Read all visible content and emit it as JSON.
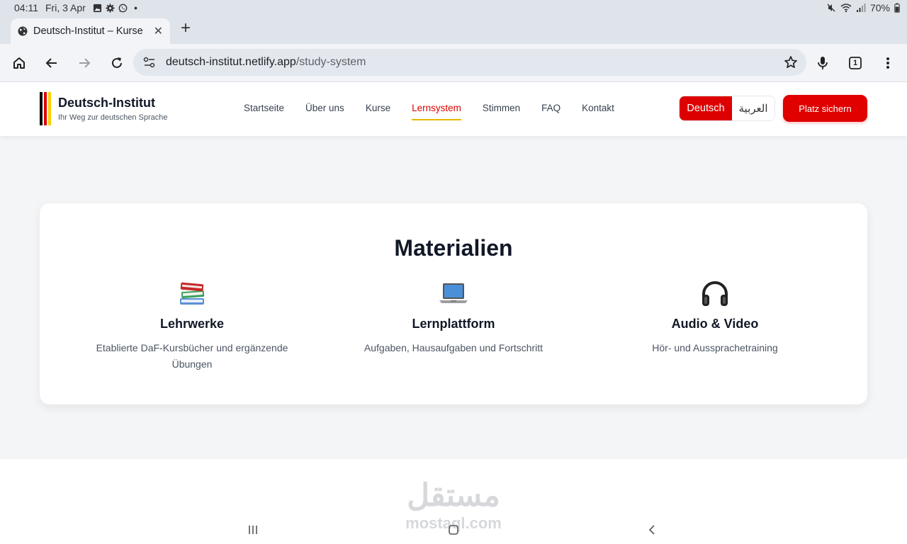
{
  "status_bar": {
    "time": "04:11",
    "date": "Fri, 3 Apr",
    "battery": "70%",
    "icons": [
      "gallery-icon",
      "settings-icon",
      "whatsapp-icon",
      "dot-icon",
      "mute-icon",
      "wifi-icon",
      "signal-icon",
      "battery-icon"
    ]
  },
  "browser": {
    "tab_title": "Deutsch-Institut – Kurse",
    "url_host": "deutsch-institut.netlify.app",
    "url_path": "/study-system",
    "tab_count": "1"
  },
  "site": {
    "brand_title": "Deutsch-Institut",
    "brand_subtitle": "Ihr Weg zur deutschen Sprache",
    "nav": [
      {
        "label": "Startseite"
      },
      {
        "label": "Über uns"
      },
      {
        "label": "Kurse"
      },
      {
        "label": "Lernsystem",
        "active": true
      },
      {
        "label": "Stimmen"
      },
      {
        "label": "FAQ"
      },
      {
        "label": "Kontakt"
      }
    ],
    "lang_de": "Deutsch",
    "lang_ar": "العربية",
    "cta": "Platz sichern",
    "colors": {
      "accent": "#dd0000",
      "gold": "#e6b800",
      "black": "#000000"
    }
  },
  "materials": {
    "title": "Materialien",
    "items": [
      {
        "icon": "books-icon",
        "title": "Lehrwerke",
        "desc_line1": "Etablierte DaF-Kursbücher und ergänzende",
        "desc_line2": "Übungen"
      },
      {
        "icon": "laptop-icon",
        "title": "Lernplattform",
        "desc_line1": "Aufgaben, Hausaufgaben und Fortschritt",
        "desc_line2": ""
      },
      {
        "icon": "headphones-icon",
        "title": "Audio & Video",
        "desc_line1": "Hör- und Aussprachetraining",
        "desc_line2": ""
      }
    ]
  },
  "watermark": {
    "arabic": "مستقل",
    "latin": "mostaql.com"
  }
}
